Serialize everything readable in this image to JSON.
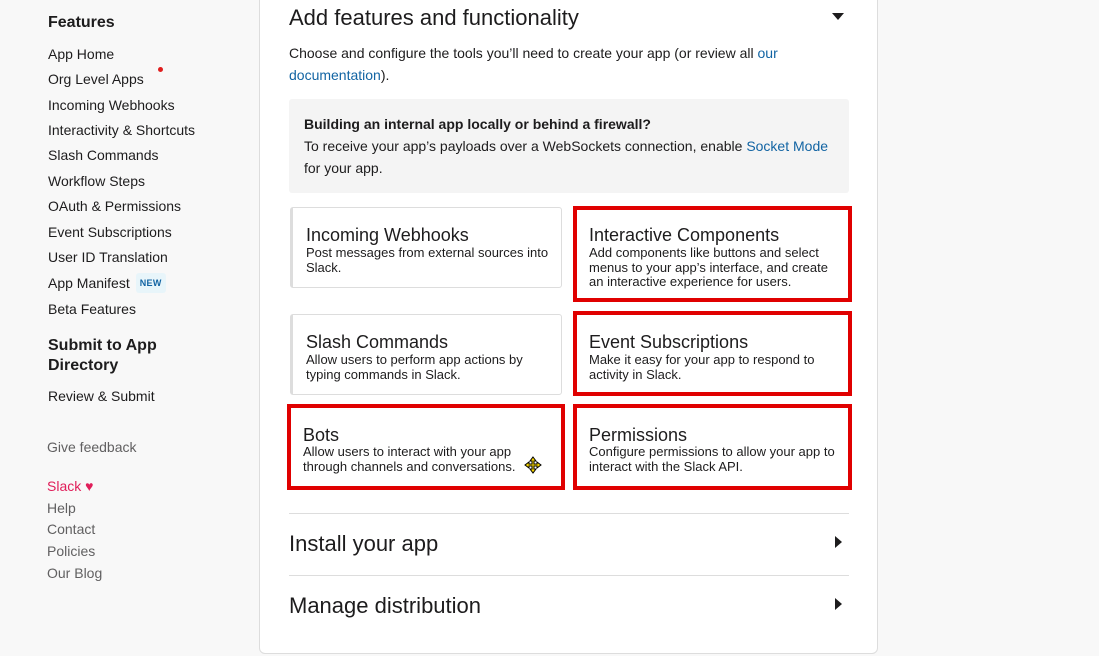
{
  "sidebar": {
    "features_heading": "Features",
    "items": [
      {
        "label": "App Home"
      },
      {
        "label": "Org Level Apps"
      },
      {
        "label": "Incoming Webhooks"
      },
      {
        "label": "Interactivity & Shortcuts"
      },
      {
        "label": "Slash Commands"
      },
      {
        "label": "Workflow Steps"
      },
      {
        "label": "OAuth & Permissions"
      },
      {
        "label": "Event Subscriptions"
      },
      {
        "label": "User ID Translation"
      },
      {
        "label": "App Manifest",
        "badge": "NEW"
      },
      {
        "label": "Beta Features"
      }
    ],
    "submit_heading": "Submit to App Directory",
    "review_submit": "Review & Submit",
    "give_feedback": "Give feedback",
    "footer": {
      "slack": "Slack",
      "heart": "♥",
      "help": "Help",
      "contact": "Contact",
      "policies": "Policies",
      "blog": "Our Blog"
    }
  },
  "main": {
    "features_section": {
      "title": "Add features and functionality",
      "intro_text": "Choose and configure the tools you’ll need to create your app (or review all ",
      "intro_link": "our documentation",
      "intro_end": ").",
      "notice": {
        "title": "Building an internal app locally or behind a firewall?",
        "body_text": "To receive your app’s payloads over a WebSockets connection, enable ",
        "body_link": "Socket Mode",
        "body_end": " for your app."
      },
      "cards": [
        {
          "title": "Incoming Webhooks",
          "description": "Post messages from external sources into Slack."
        },
        {
          "title": "Interactive Components",
          "description": "Add components like buttons and select menus to your app’s interface, and create an interactive experience for users."
        },
        {
          "title": "Slash Commands",
          "description": "Allow users to perform app actions by typing commands in Slack."
        },
        {
          "title": "Event Subscriptions",
          "description": "Make it easy for your app to respond to activity in Slack."
        },
        {
          "title": "Bots",
          "description": "Allow users to interact with your app through channels and conversations."
        },
        {
          "title": "Permissions",
          "description": "Configure permissions to allow your app to interact with the Slack API."
        }
      ]
    },
    "install_section": {
      "title": "Install your app"
    },
    "distribution_section": {
      "title": "Manage distribution"
    }
  },
  "colors": {
    "highlight": "#e00000",
    "link": "#1264a3",
    "slack_pink": "#e01e5a"
  }
}
